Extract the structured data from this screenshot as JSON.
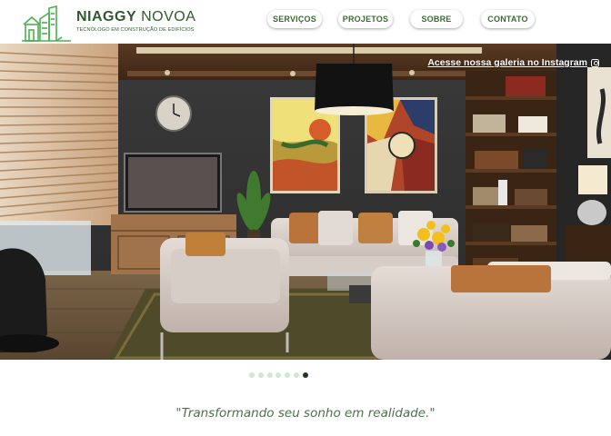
{
  "brand": {
    "name_bold": "NIAGGY",
    "name_light": "NOVOA",
    "tagline": "TECNÓLOGO EM CONSTRUÇÃO DE EDIFÍCIOS",
    "color": "#3b6b32",
    "logo_icon": "house-buildings-logo-icon"
  },
  "nav": {
    "items": [
      {
        "label": "SERVIÇOS"
      },
      {
        "label": "PROJETOS"
      },
      {
        "label": "SOBRE"
      },
      {
        "label": "CONTATO"
      }
    ]
  },
  "hero": {
    "gallery_link": "Acesse nossa galeria no Instagram",
    "gallery_icon": "instagram-icon",
    "image_subject": "living-room-interior"
  },
  "carousel": {
    "count": 7,
    "active_index": 6,
    "dot_color": "#cfe8cf",
    "active_color": "#1e3a1e"
  },
  "quote": {
    "text": "\"Transformando seu sonho em realidade.\""
  }
}
